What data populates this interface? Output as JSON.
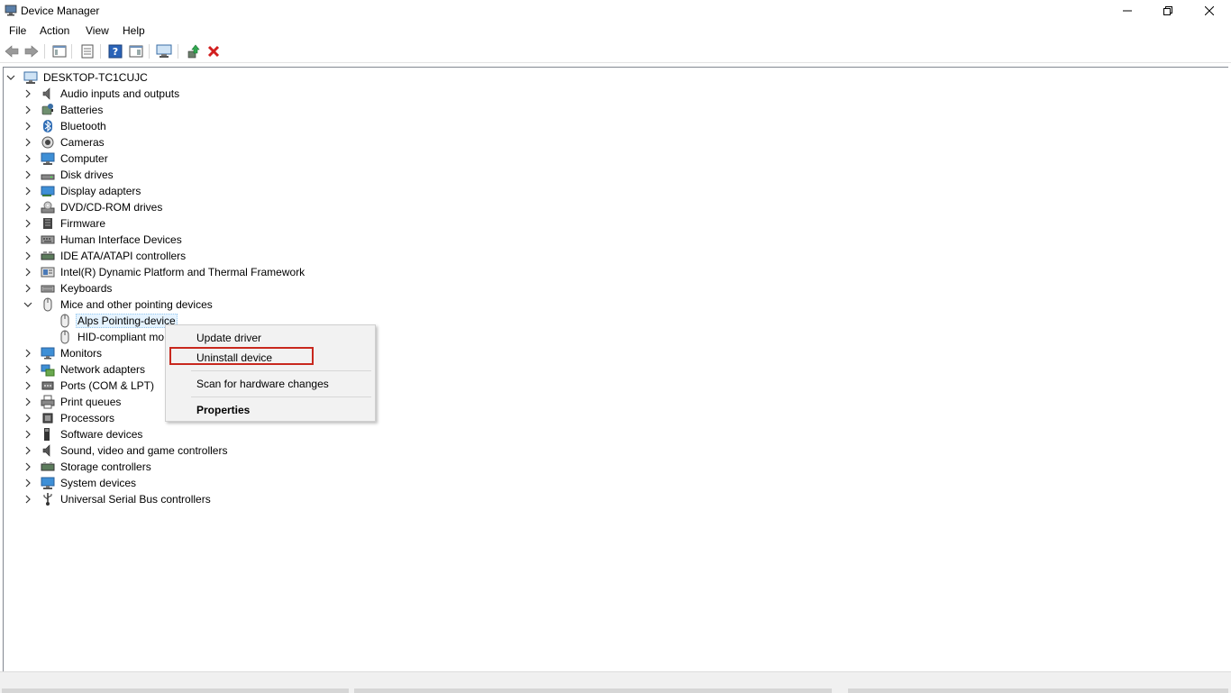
{
  "window": {
    "title": "Device Manager",
    "controls": {
      "minimize": "—",
      "maximize": "❐",
      "close": "✕"
    }
  },
  "menu": [
    "File",
    "Action",
    "View",
    "Help"
  ],
  "toolbar": {
    "buttons": [
      "back-arrow-icon",
      "forward-arrow-icon",
      "show-hide-console-tree-icon",
      "properties-icon",
      "help-icon",
      "action-pane-icon",
      "scan-hardware-icon",
      "update-driver-icon",
      "uninstall-icon"
    ]
  },
  "tree": {
    "root": "DESKTOP-TC1CUJC",
    "categories": [
      {
        "label": "Audio inputs and outputs",
        "icon": "speaker-icon",
        "expanded": false
      },
      {
        "label": "Batteries",
        "icon": "battery-icon",
        "expanded": false
      },
      {
        "label": "Bluetooth",
        "icon": "bluetooth-icon",
        "expanded": false
      },
      {
        "label": "Cameras",
        "icon": "camera-icon",
        "expanded": false
      },
      {
        "label": "Computer",
        "icon": "computer-icon",
        "expanded": false
      },
      {
        "label": "Disk drives",
        "icon": "disk-drive-icon",
        "expanded": false
      },
      {
        "label": "Display adapters",
        "icon": "display-adapter-icon",
        "expanded": false
      },
      {
        "label": "DVD/CD-ROM drives",
        "icon": "dvd-icon",
        "expanded": false
      },
      {
        "label": "Firmware",
        "icon": "firmware-icon",
        "expanded": false
      },
      {
        "label": "Human Interface Devices",
        "icon": "hid-icon",
        "expanded": false
      },
      {
        "label": "IDE ATA/ATAPI controllers",
        "icon": "ide-controller-icon",
        "expanded": false
      },
      {
        "label": "Intel(R) Dynamic Platform and Thermal Framework",
        "icon": "intel-framework-icon",
        "expanded": false
      },
      {
        "label": "Keyboards",
        "icon": "keyboard-icon",
        "expanded": false
      },
      {
        "label": "Mice and other pointing devices",
        "icon": "mouse-icon",
        "expanded": true,
        "children": [
          {
            "label": "Alps Pointing-device",
            "icon": "mouse-icon",
            "selected": true
          },
          {
            "label": "HID-compliant mo",
            "icon": "mouse-icon",
            "selected": false
          }
        ]
      },
      {
        "label": "Monitors",
        "icon": "monitor-icon",
        "expanded": false
      },
      {
        "label": "Network adapters",
        "icon": "network-adapter-icon",
        "expanded": false
      },
      {
        "label": "Ports (COM & LPT)",
        "icon": "port-icon",
        "expanded": false
      },
      {
        "label": "Print queues",
        "icon": "printer-icon",
        "expanded": false
      },
      {
        "label": "Processors",
        "icon": "processor-icon",
        "expanded": false
      },
      {
        "label": "Software devices",
        "icon": "software-device-icon",
        "expanded": false
      },
      {
        "label": "Sound, video and game controllers",
        "icon": "sound-controller-icon",
        "expanded": false
      },
      {
        "label": "Storage controllers",
        "icon": "storage-controller-icon",
        "expanded": false
      },
      {
        "label": "System devices",
        "icon": "system-device-icon",
        "expanded": false
      },
      {
        "label": "Universal Serial Bus controllers",
        "icon": "usb-icon",
        "expanded": false
      }
    ]
  },
  "context_menu": {
    "items": [
      "Update driver",
      "Uninstall device",
      "Scan for hardware changes",
      "Properties"
    ],
    "highlighted": "Uninstall device",
    "highlight_color": "#c8281e"
  }
}
